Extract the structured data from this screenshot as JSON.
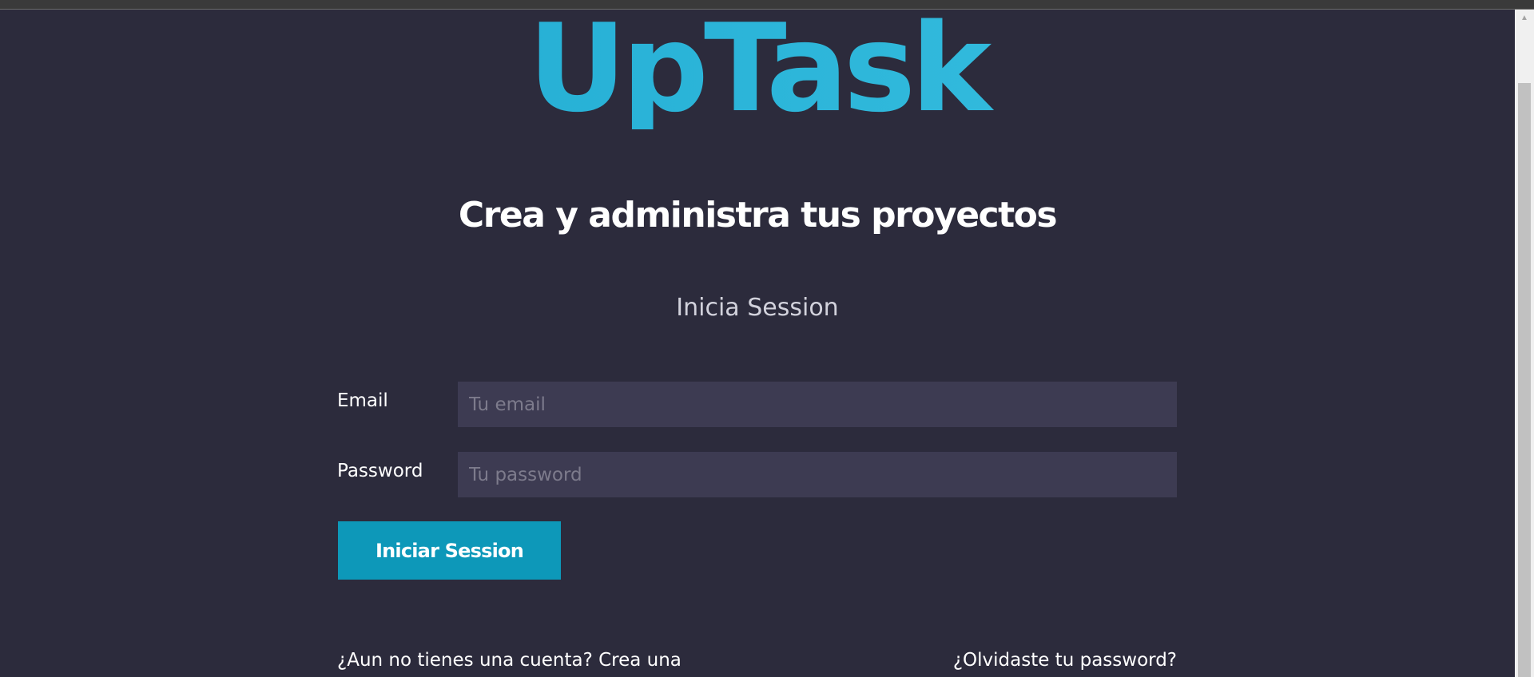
{
  "brand": {
    "logo_text": "UpTask",
    "accent_color": "#28b3d7"
  },
  "hero": {
    "tagline": "Crea y administra tus proyectos",
    "subtitle": "Inicia Session"
  },
  "login_form": {
    "email": {
      "label": "Email",
      "placeholder": "Tu email",
      "value": ""
    },
    "password": {
      "label": "Password",
      "placeholder": "Tu password",
      "value": ""
    },
    "submit_label": "Iniciar Session",
    "submit_color": "#0d98b9"
  },
  "links": {
    "create_account": "¿Aun no tienes una cuenta? Crea una",
    "forgot_password": "¿Olvidaste tu password?"
  },
  "scrollbar": {
    "up_arrow_icon": "chevron-up-icon"
  }
}
